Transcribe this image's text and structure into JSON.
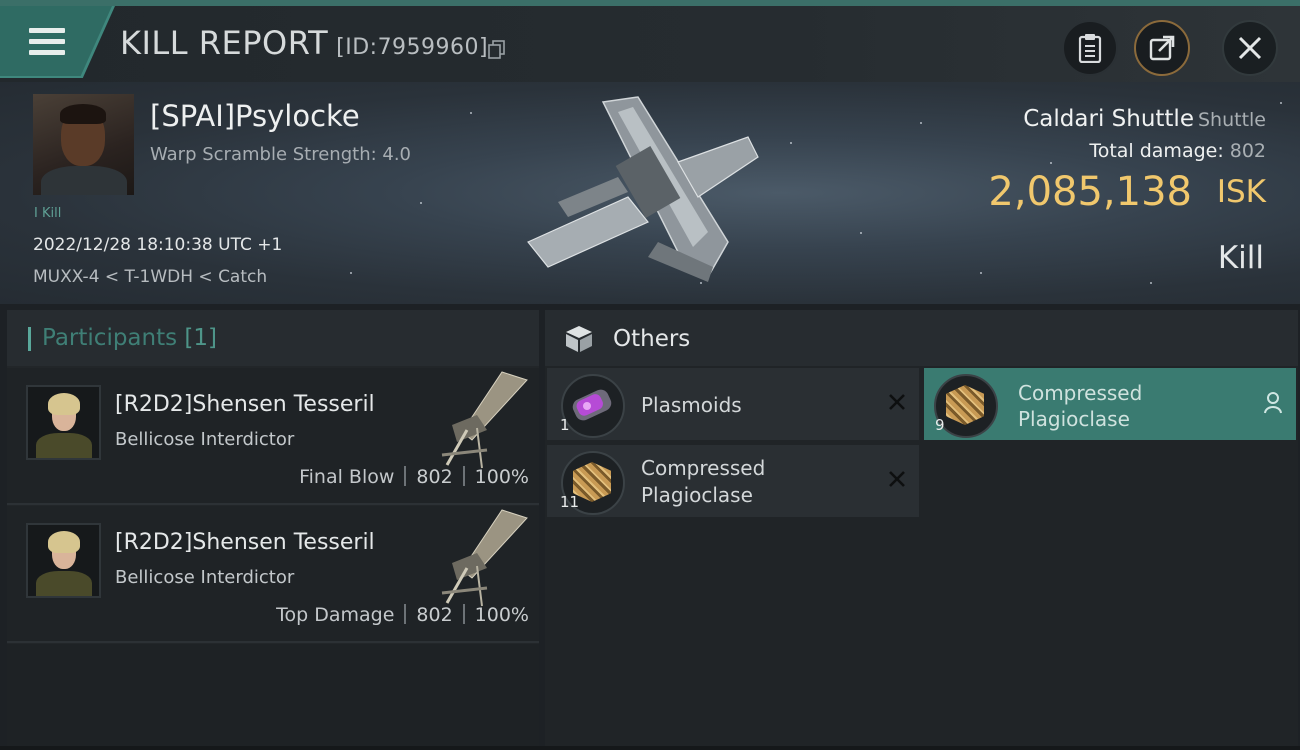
{
  "header": {
    "title": "KILL REPORT",
    "report_id": "[ID:7959960]",
    "buttons": [
      "clipboard-icon",
      "share-icon",
      "close-icon"
    ]
  },
  "victim": {
    "name": "[SPAI]Psylocke",
    "warp_scramble": "Warp Scramble Strength: 4.0",
    "kill_tag": "I Kill",
    "datetime": "2022/12/28 18:10:38 UTC +1",
    "location": "MUXX-4 < T-1WDH < Catch",
    "ship_name": "Caldari Shuttle",
    "ship_class": "Shuttle",
    "total_damage_label": "Total damage:",
    "total_damage_value": "802",
    "isk_value": "2,085,138",
    "isk_unit": "ISK",
    "result": "Kill"
  },
  "participants": {
    "title": "Participants",
    "count": "[1]",
    "rows": [
      {
        "name": "[R2D2]Shensen Tesseril",
        "ship": "Bellicose Interdictor",
        "label": "Final Blow",
        "damage": "802",
        "percent": "100%"
      },
      {
        "name": "[R2D2]Shensen Tesseril",
        "ship": "Bellicose Interdictor",
        "label": "Top Damage",
        "damage": "802",
        "percent": "100%"
      }
    ]
  },
  "others": {
    "title": "Others",
    "items": [
      {
        "qty": "1",
        "name_line1": "Plasmoids",
        "name_line2": "",
        "state": "destroyed"
      },
      {
        "qty": "11",
        "name_line1": "Compressed",
        "name_line2": "Plagioclase",
        "state": "destroyed"
      },
      {
        "qty": "9",
        "name_line1": "Compressed",
        "name_line2": "Plagioclase",
        "state": "dropped"
      }
    ]
  },
  "colors": {
    "accent_teal": "#3f877d",
    "isk_gold": "#f1c86d",
    "selected_item": "#3a7b71"
  }
}
